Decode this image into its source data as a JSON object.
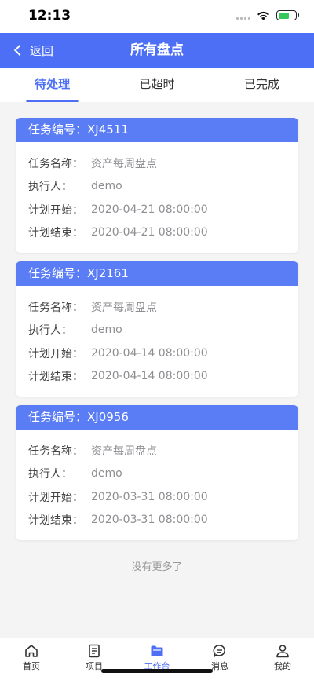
{
  "status": {
    "time": "12:13"
  },
  "nav": {
    "back_label": "返回",
    "title": "所有盘点"
  },
  "tabs": [
    {
      "label": "待处理",
      "active": true
    },
    {
      "label": "已超时",
      "active": false
    },
    {
      "label": "已完成",
      "active": false
    }
  ],
  "field_labels": {
    "task_no": "任务编号：",
    "task_name": "任务名称：",
    "executor": "执行人：",
    "plan_start": "计划开始：",
    "plan_end": "计划结束："
  },
  "tasks": [
    {
      "task_no": "XJ4511",
      "task_name": "资产每周盘点",
      "executor": "demo",
      "plan_start": "2020-04-21 08:00:00",
      "plan_end": "2020-04-21 08:00:00"
    },
    {
      "task_no": "XJ2161",
      "task_name": "资产每周盘点",
      "executor": "demo",
      "plan_start": "2020-04-14 08:00:00",
      "plan_end": "2020-04-14 08:00:00"
    },
    {
      "task_no": "XJ0956",
      "task_name": "资产每周盘点",
      "executor": "demo",
      "plan_start": "2020-03-31 08:00:00",
      "plan_end": "2020-03-31 08:00:00"
    }
  ],
  "no_more_text": "没有更多了",
  "tabbar": [
    {
      "label": "首页",
      "icon": "home-icon",
      "active": false
    },
    {
      "label": "项目",
      "icon": "document-icon",
      "active": false
    },
    {
      "label": "工作台",
      "icon": "folder-icon",
      "active": true
    },
    {
      "label": "消息",
      "icon": "message-icon",
      "active": false
    },
    {
      "label": "我的",
      "icon": "user-icon",
      "active": false
    }
  ],
  "colors": {
    "primary": "#4c6ff5",
    "card_header": "#5a7df5",
    "battery": "#35c759"
  }
}
